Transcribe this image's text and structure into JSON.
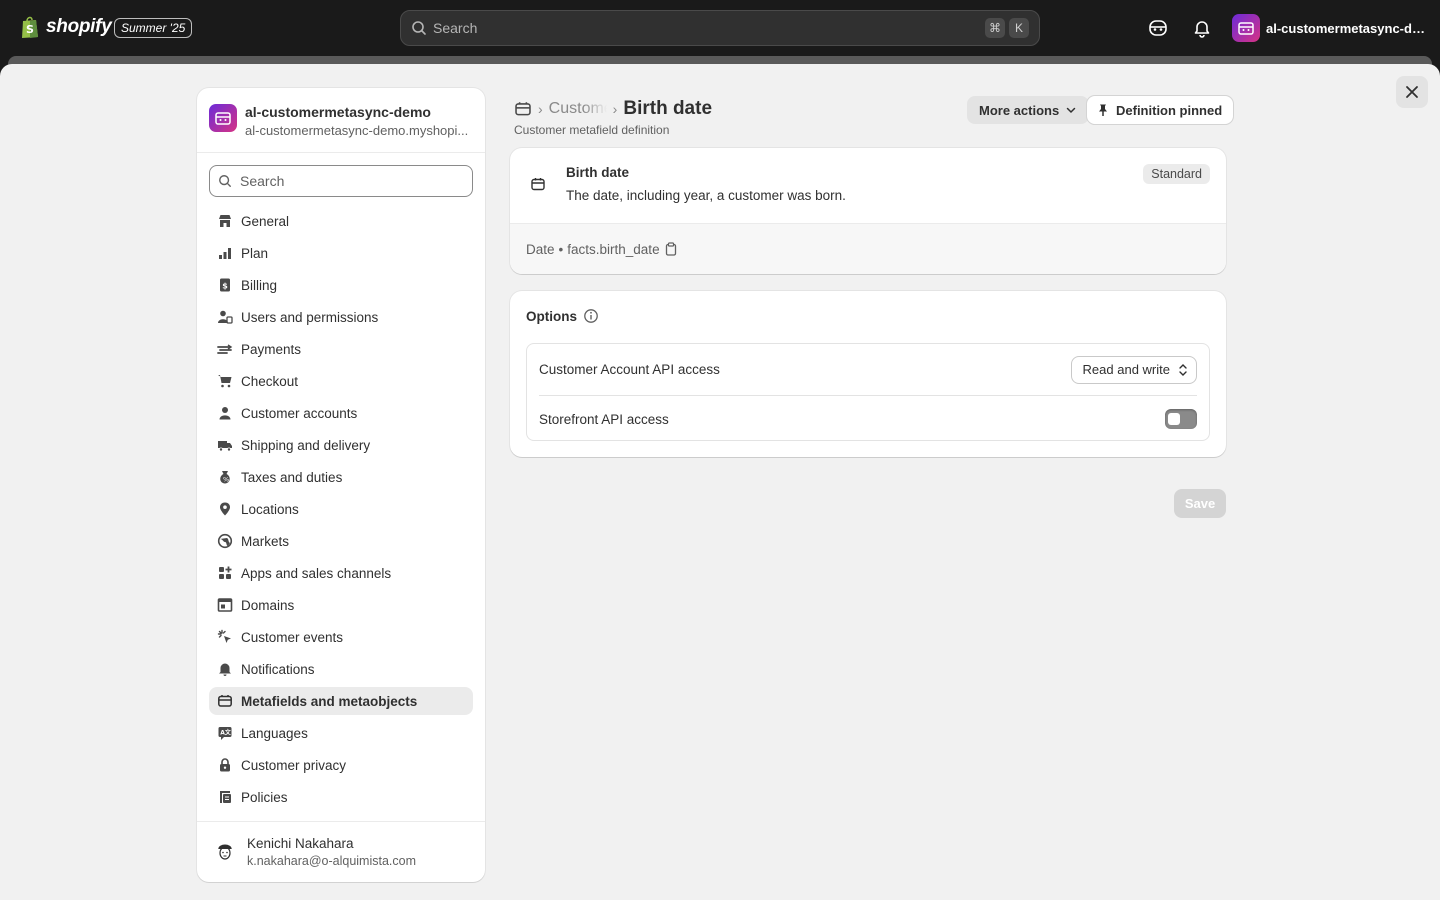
{
  "topbar": {
    "brand": "shopify",
    "edition": "Summer '25",
    "search_placeholder": "Search",
    "shortcut_keys": [
      "⌘",
      "K"
    ],
    "store_name": "al-customermetasync-de...",
    "icons": [
      "sidekick-icon",
      "bell-icon"
    ]
  },
  "sidebar": {
    "store_title": "al-customermetasync-demo",
    "store_domain": "al-customermetasync-demo.myshopi...",
    "search_placeholder": "Search",
    "items": [
      {
        "label": "General",
        "icon": "store-icon"
      },
      {
        "label": "Plan",
        "icon": "plan-icon"
      },
      {
        "label": "Billing",
        "icon": "billing-icon"
      },
      {
        "label": "Users and permissions",
        "icon": "users-icon"
      },
      {
        "label": "Payments",
        "icon": "payments-icon"
      },
      {
        "label": "Checkout",
        "icon": "cart-icon"
      },
      {
        "label": "Customer accounts",
        "icon": "person-icon"
      },
      {
        "label": "Shipping and delivery",
        "icon": "truck-icon"
      },
      {
        "label": "Taxes and duties",
        "icon": "tax-icon"
      },
      {
        "label": "Locations",
        "icon": "location-icon"
      },
      {
        "label": "Markets",
        "icon": "globe-icon"
      },
      {
        "label": "Apps and sales channels",
        "icon": "apps-icon"
      },
      {
        "label": "Domains",
        "icon": "domain-icon"
      },
      {
        "label": "Customer events",
        "icon": "cursor-icon"
      },
      {
        "label": "Notifications",
        "icon": "bell-icon"
      },
      {
        "label": "Metafields and metaobjects",
        "icon": "metafield-icon",
        "active": true
      },
      {
        "label": "Languages",
        "icon": "language-icon"
      },
      {
        "label": "Customer privacy",
        "icon": "lock-icon"
      },
      {
        "label": "Policies",
        "icon": "policy-icon"
      }
    ],
    "user": {
      "name": "Kenichi Nakahara",
      "email": "k.nakahara@o-alquimista.com"
    }
  },
  "header": {
    "breadcrumb_parent": "Customers",
    "title": "Birth date",
    "subtitle": "Customer metafield definition",
    "more_actions_label": "More actions",
    "pinned_label": "Definition pinned"
  },
  "definition_card": {
    "name": "Birth date",
    "description": "The date, including year, a customer was born.",
    "badge": "Standard",
    "type": "Date",
    "bullet": "•",
    "key": "facts.birth_date"
  },
  "options_card": {
    "heading": "Options",
    "rows": [
      {
        "label": "Customer Account API access",
        "value": "Read and write"
      },
      {
        "label": "Storefront API access",
        "toggle_on": false
      }
    ]
  },
  "footer": {
    "save_label": "Save"
  },
  "colors": {
    "topbar": "#1a1a1a",
    "sheet": "#f1f1f1",
    "active_nav": "#ebebeb",
    "toggle_off": "#8a8a8a",
    "save_disabled": "#d4d4d4"
  }
}
